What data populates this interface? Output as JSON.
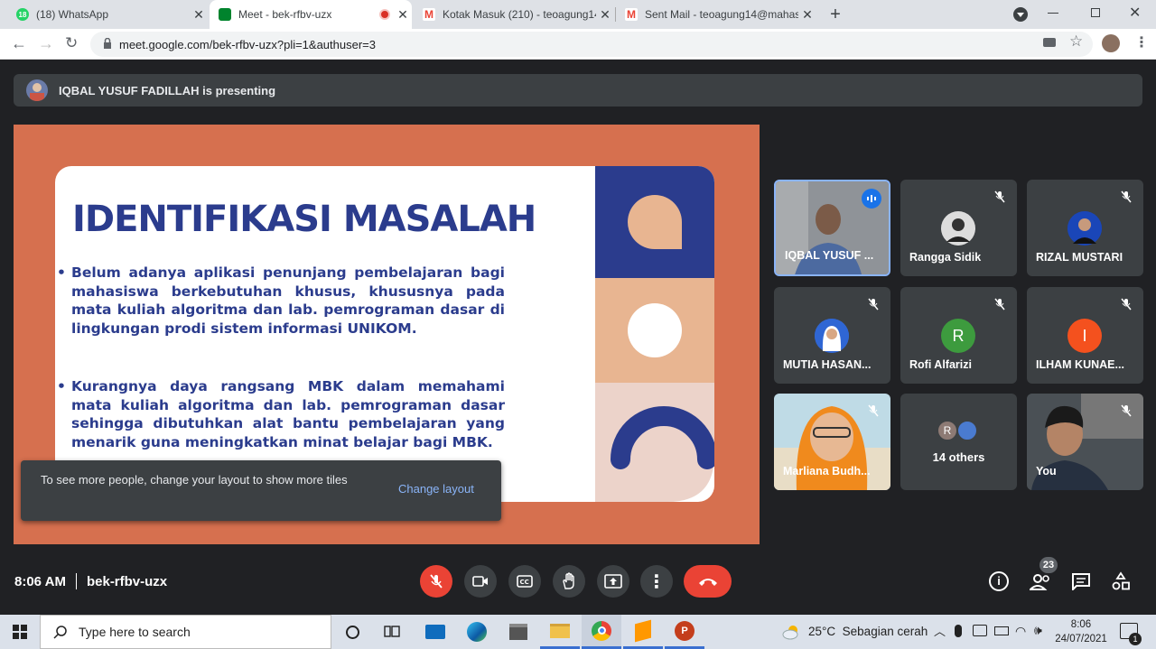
{
  "browser": {
    "tabs": [
      {
        "title": "(18) WhatsApp",
        "badge": "18"
      },
      {
        "title": "Meet - bek-rfbv-uzx"
      },
      {
        "title": "Kotak Masuk (210) - teoagung14"
      },
      {
        "title": "Sent Mail - teoagung14@mahasi"
      }
    ],
    "url": "meet.google.com/bek-rfbv-uzx?pli=1&authuser=3"
  },
  "meet": {
    "presenting": "IQBAL YUSUF FADILLAH is presenting",
    "slide": {
      "title": "IDENTIFIKASI MASALAH",
      "bullet1": "Belum adanya aplikasi penunjang pembelajaran bagi mahasiswa berkebutuhan khusus, khususnya pada mata kuliah algoritma dan lab. pemrograman dasar di lingkungan prodi sistem informasi UNIKOM.",
      "bullet2": "Kurangnya daya rangsang MBK dalam memahami mata kuliah algoritma dan lab. pemrograman dasar sehingga dibutuhkan alat bantu pembelajaran yang menarik guna meningkatkan minat belajar bagi MBK."
    },
    "participants": [
      {
        "name": "IQBAL YUSUF ...",
        "initial": ""
      },
      {
        "name": "Rangga Sidik",
        "initial": ""
      },
      {
        "name": "RIZAL MUSTARI",
        "initial": ""
      },
      {
        "name": "MUTIA HASAN...",
        "initial": ""
      },
      {
        "name": "Rofi Alfarizi",
        "initial": "R"
      },
      {
        "name": "ILHAM KUNAE...",
        "initial": "I"
      },
      {
        "name": "Marliana Budh...",
        "initial": ""
      },
      {
        "name": "14 others",
        "initial": "R"
      },
      {
        "name": "You",
        "initial": ""
      }
    ],
    "toast": {
      "text": "To see more people, change your layout to show more tiles",
      "action": "Change layout"
    },
    "time": "8:06 AM",
    "code": "bek-rfbv-uzx",
    "people_count": "23"
  },
  "taskbar": {
    "search_placeholder": "Type here to search",
    "weather": "25°C  Sebagian cerah",
    "time": "8:06",
    "date": "24/07/2021",
    "notif": "1"
  },
  "colors": {
    "accent": "#8ab4f8",
    "end_call": "#ea4335",
    "slide_bg": "#d6704f",
    "slide_text": "#2b3c8d"
  }
}
